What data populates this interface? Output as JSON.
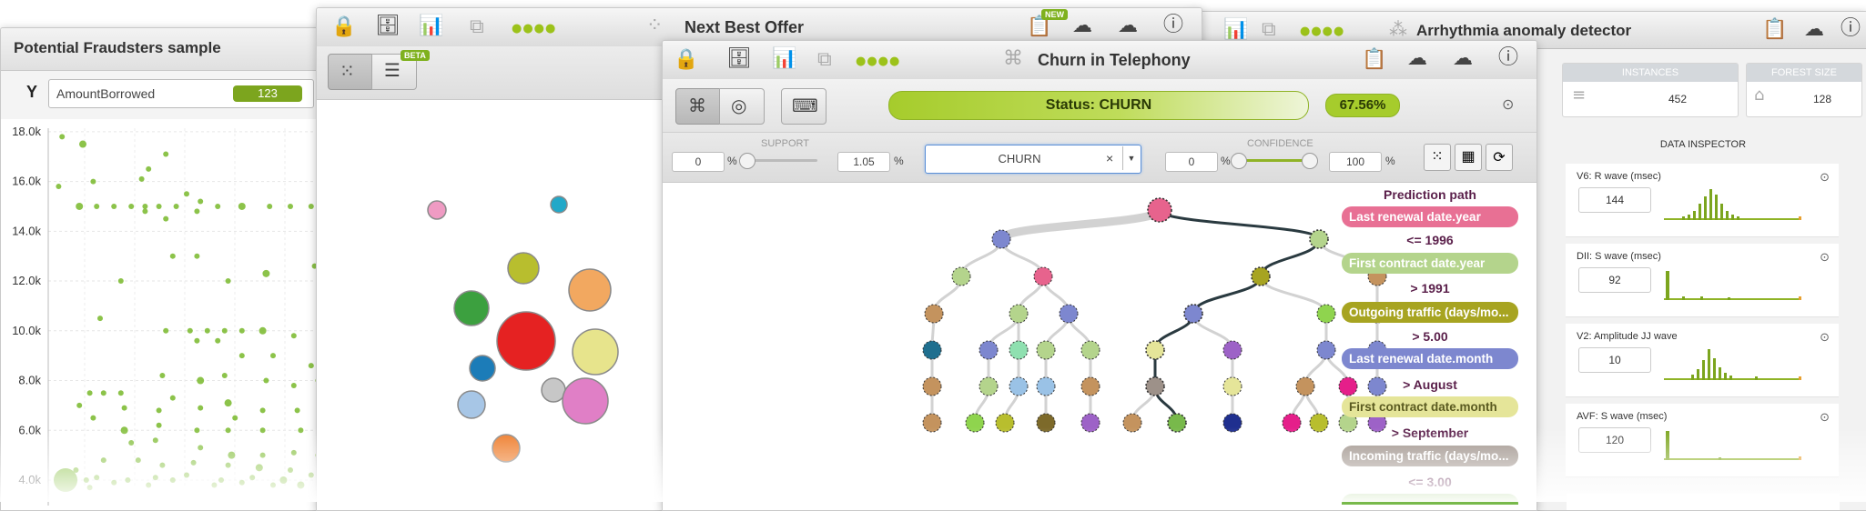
{
  "fraud": {
    "title": "Potential Fraudsters sample",
    "y_axis_letter": "Y",
    "field_value": "AmountBorrowed",
    "field_badge": "123",
    "chart_data": {
      "type": "scatter",
      "title": "Potential Fraudsters sample",
      "ylabel": "AmountBorrowed",
      "ylim": [
        4000,
        18000
      ],
      "yticks": [
        "18.0k",
        "16.0k",
        "14.0k",
        "12.0k",
        "10.0k",
        "8.0k",
        "6.0k",
        "4.0k"
      ],
      "points": [
        [
          1,
          17500
        ],
        [
          0.4,
          17800
        ],
        [
          1.3,
          16000
        ],
        [
          2.7,
          16100
        ],
        [
          2.9,
          16500
        ],
        [
          3.4,
          17100
        ],
        [
          0.3,
          15800
        ],
        [
          4,
          15500
        ],
        [
          4.4,
          15200
        ],
        [
          0.9,
          15000
        ],
        [
          1.4,
          15000
        ],
        [
          1.9,
          15000
        ],
        [
          2.4,
          15000
        ],
        [
          2.8,
          15000
        ],
        [
          3.2,
          15000
        ],
        [
          3.7,
          15000
        ],
        [
          4.3,
          14800
        ],
        [
          4.9,
          15000
        ],
        [
          5.6,
          15000
        ],
        [
          6.4,
          15000
        ],
        [
          7,
          15000
        ],
        [
          7.6,
          15000
        ],
        [
          2.8,
          14800
        ],
        [
          3.4,
          14500
        ],
        [
          3.6,
          13000
        ],
        [
          4.3,
          13000
        ],
        [
          5.2,
          12000
        ],
        [
          6.3,
          12300
        ],
        [
          7.7,
          12600
        ],
        [
          2.1,
          12000
        ],
        [
          1.5,
          10500
        ],
        [
          3.4,
          10000
        ],
        [
          4.1,
          10000
        ],
        [
          4.6,
          10000
        ],
        [
          5.1,
          10000
        ],
        [
          5.6,
          10000
        ],
        [
          6.2,
          10000
        ],
        [
          7.1,
          9800
        ],
        [
          4.3,
          9600
        ],
        [
          4.9,
          9600
        ],
        [
          5.6,
          9000
        ],
        [
          6.5,
          9000
        ],
        [
          7.6,
          8600
        ],
        [
          7.9,
          9500
        ],
        [
          3.3,
          8200
        ],
        [
          4.4,
          8000
        ],
        [
          5.1,
          8200
        ],
        [
          6.3,
          8000
        ],
        [
          7.1,
          7800
        ],
        [
          7.8,
          8000
        ],
        [
          1.2,
          7500
        ],
        [
          1.6,
          7500
        ],
        [
          2.1,
          7500
        ],
        [
          3.6,
          7300
        ],
        [
          5.2,
          7100
        ],
        [
          0.9,
          7000
        ],
        [
          2.2,
          6900
        ],
        [
          3.2,
          6800
        ],
        [
          4.4,
          6900
        ],
        [
          5.4,
          6500
        ],
        [
          6.2,
          6800
        ],
        [
          7.2,
          6800
        ],
        [
          1.3,
          6500
        ],
        [
          2.2,
          6000
        ],
        [
          3.2,
          6200
        ],
        [
          4.3,
          6000
        ],
        [
          5.2,
          6000
        ],
        [
          6.2,
          6000
        ],
        [
          7.3,
          6000
        ],
        [
          2.4,
          5500
        ],
        [
          3.1,
          5600
        ],
        [
          4.4,
          5300
        ],
        [
          5.3,
          5000
        ],
        [
          6.2,
          5000
        ],
        [
          7.1,
          5100
        ],
        [
          7.8,
          5000
        ],
        [
          1.6,
          4800
        ],
        [
          2.6,
          4800
        ],
        [
          3.3,
          4600
        ],
        [
          4.2,
          4700
        ],
        [
          5.2,
          4600
        ],
        [
          6.1,
          4500
        ],
        [
          7,
          4400
        ],
        [
          0.8,
          4400
        ],
        [
          1.4,
          4100
        ],
        [
          2.3,
          4000
        ],
        [
          3.1,
          4100
        ],
        [
          4,
          4200
        ],
        [
          5,
          4000
        ],
        [
          5.9,
          4100
        ],
        [
          6.8,
          4000
        ],
        [
          7.6,
          4200
        ],
        [
          1.1,
          4000
        ],
        [
          1.9,
          3900
        ],
        [
          2.9,
          3800
        ],
        [
          3.6,
          4000
        ],
        [
          4.8,
          3800
        ],
        [
          5.6,
          3900
        ],
        [
          6.5,
          3800
        ],
        [
          7.3,
          3800
        ],
        [
          0.5,
          4000
        ],
        [
          1.2,
          3700
        ]
      ]
    }
  },
  "nbo": {
    "title": "Next Best Offer",
    "new_badge": "NEW",
    "beta_badge": "BETA",
    "bubble_colors": [
      "#ef9bc3",
      "#22a8c8",
      "#b8be2e",
      "#3ca03f",
      "#f2a860",
      "#e52222",
      "#1c7cb8",
      "#e7e48c",
      "#a7c6e6",
      "#c7c7c7",
      "#e07fc6",
      "#ee7a27"
    ]
  },
  "arrhythmia": {
    "title": "Arrhythmia anomaly detector",
    "stats": [
      {
        "label": "INSTANCES",
        "value": "452"
      },
      {
        "label": "FOREST SIZE",
        "value": "128"
      }
    ],
    "inspector_title": "DATA INSPECTOR",
    "fields": [
      {
        "name": "V6: R wave (msec)",
        "value": "144"
      },
      {
        "name": "DII: S wave (msec)",
        "value": "92"
      },
      {
        "name": "V2: Amplitude JJ wave",
        "value": "10"
      },
      {
        "name": "AVF: S wave (msec)",
        "value": "120"
      }
    ]
  },
  "churn": {
    "title": "Churn in Telephony",
    "status_text": "Status: CHURN",
    "confidence_pct": "67.56%",
    "support": {
      "label": "SUPPORT",
      "min": "0",
      "max": "1.05",
      "unit": "%"
    },
    "filter_value": "CHURN",
    "confidence": {
      "label": "CONFIDENCE",
      "min": "0",
      "max": "100",
      "unit": "%"
    },
    "prediction_path": {
      "title": "Prediction path",
      "steps": [
        {
          "field": "Last renewal date.year",
          "color": "#e87094"
        },
        {
          "condition": "<= 1996"
        },
        {
          "field": "First contract date.year",
          "color": "#b4d48c"
        },
        {
          "condition": "> 1991"
        },
        {
          "field": "Outgoing traffic (days/mo...",
          "color": "#a7a421"
        },
        {
          "condition": "> 5.00"
        },
        {
          "field": "Last renewal date.month",
          "color": "#7d87cf"
        },
        {
          "condition": "> August"
        },
        {
          "field": "First contract date.month",
          "color": "#e5e599",
          "dark_text": true
        },
        {
          "condition": "> September"
        },
        {
          "field": "Incoming traffic (days/mo...",
          "color": "#9d9189"
        },
        {
          "condition": "<= 3.00"
        }
      ]
    }
  }
}
